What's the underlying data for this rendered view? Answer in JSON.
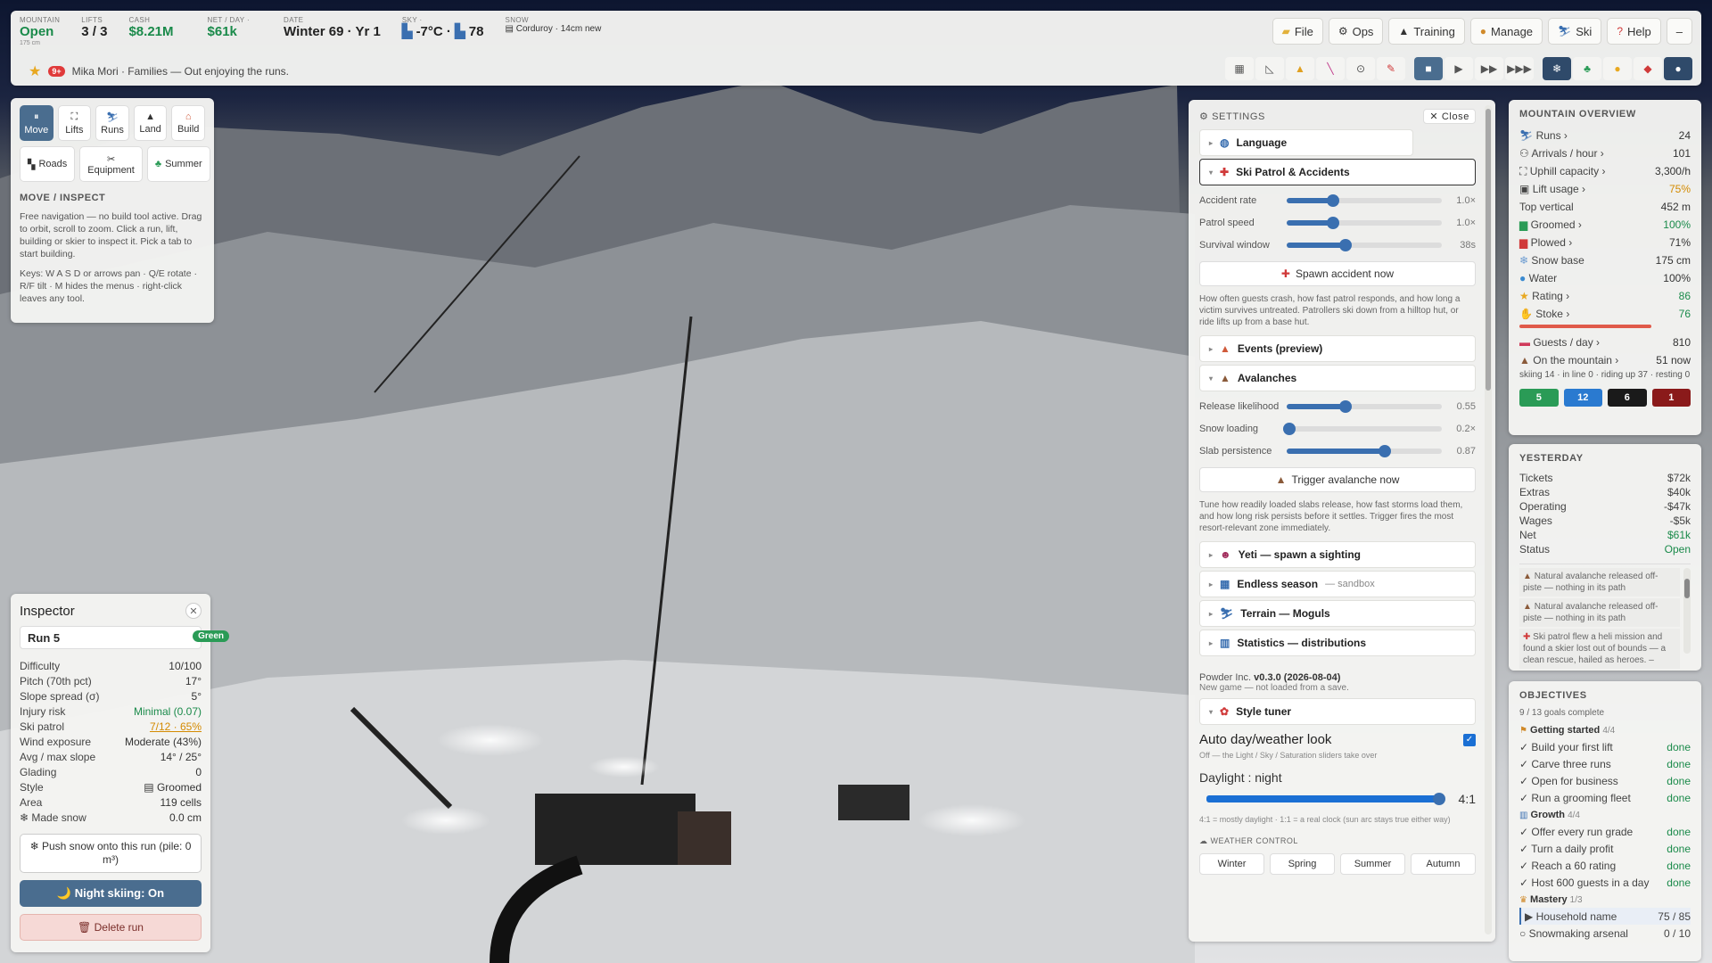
{
  "status": {
    "mountain": {
      "label": "MOUNTAIN",
      "value": "Open",
      "sub": "175 cm"
    },
    "lifts": {
      "label": "LIFTS",
      "value": "3 / 3"
    },
    "cash": {
      "label": "CASH",
      "value": "$8.21M"
    },
    "net": {
      "label": "NET / DAY ·",
      "value": "$61k"
    },
    "date": {
      "label": "DATE",
      "value": "Winter 69 · Yr 1"
    },
    "sky": {
      "label": "SKY ·",
      "temp": "-7°C ·",
      "value": "78"
    },
    "snow": {
      "label": "SNOW",
      "value": "Corduroy · 14cm new"
    }
  },
  "menu": [
    {
      "label": "File",
      "icon": "folder-icon"
    },
    {
      "label": "Ops",
      "icon": "gear-icon"
    },
    {
      "label": "Training",
      "icon": "cap-icon"
    },
    {
      "label": "Manage",
      "icon": "bag-icon"
    },
    {
      "label": "Ski",
      "icon": "skier-icon"
    },
    {
      "label": "Help",
      "icon": "question-icon"
    }
  ],
  "minimize": "–",
  "notification": {
    "count": "9+",
    "text": "Mika Mori · Families — Out enjoying the runs."
  },
  "tools": {
    "items": [
      {
        "label": "Move"
      },
      {
        "label": "Lifts"
      },
      {
        "label": "Runs"
      },
      {
        "label": "Land"
      },
      {
        "label": "Build"
      }
    ],
    "items2": [
      {
        "label": "Roads"
      },
      {
        "label": "Equipment"
      },
      {
        "label": "Summer"
      }
    ],
    "heading": "MOVE / INSPECT",
    "desc": "Free navigation — no build tool active. Drag to orbit, scroll to zoom. Click a run, lift, building or skier to inspect it. Pick a tab to start building.",
    "keys": "Keys: W A S D or arrows pan · Q/E rotate · R/F tilt · M hides the menus · right-click leaves any tool."
  },
  "inspector": {
    "title": "Inspector",
    "run": "Run 5",
    "grade": "Green",
    "rows": [
      {
        "k": "Difficulty",
        "v": "10/100"
      },
      {
        "k": "Pitch (70th pct)",
        "v": "17°"
      },
      {
        "k": "Slope spread (σ)",
        "v": "5°"
      },
      {
        "k": "Injury risk",
        "v": "Minimal (0.07)"
      },
      {
        "k": "Ski patrol",
        "v": "7/12 · 65%"
      },
      {
        "k": "Wind exposure",
        "v": "Moderate (43%)"
      },
      {
        "k": "Avg / max slope",
        "v": "14° / 25°"
      },
      {
        "k": "Glading",
        "v": "0"
      },
      {
        "k": "Style",
        "v": "▤ Groomed"
      },
      {
        "k": "Area",
        "v": "119 cells"
      },
      {
        "k": "❄ Made snow",
        "v": "0.0 cm"
      }
    ],
    "push": "❄ Push snow onto this run (pile: 0 m³)",
    "night": "🌙 Night skiing: On",
    "delete": "🗑 Delete run"
  },
  "settings": {
    "title": "SETTINGS",
    "close": "✕ Close",
    "language": "Language",
    "patrol": "Ski Patrol & Accidents",
    "patrol_sliders": [
      {
        "k": "Accident rate",
        "v": "1.0×",
        "frac": 0.3
      },
      {
        "k": "Patrol speed",
        "v": "1.0×",
        "frac": 0.3
      },
      {
        "k": "Survival window",
        "v": "38s",
        "frac": 0.38
      }
    ],
    "spawn": "Spawn accident now",
    "patrol_desc": "How often guests crash, how fast patrol responds, and how long a victim survives untreated. Patrollers ski down from a hilltop hut, or ride lifts up from a base hut.",
    "events": "Events (preview)",
    "avalanches": "Avalanches",
    "aval_sliders": [
      {
        "k": "Release likelihood",
        "v": "0.55",
        "frac": 0.38
      },
      {
        "k": "Snow loading",
        "v": "0.2×",
        "frac": 0.02
      },
      {
        "k": "Slab persistence",
        "v": "0.87",
        "frac": 0.63
      }
    ],
    "trigger": "Trigger avalanche now",
    "aval_desc": "Tune how readily loaded slabs release, how fast storms load them, and how long risk persists before it settles. Trigger fires the most resort-relevant zone immediately.",
    "yeti": "Yeti — spawn a sighting",
    "endless": "Endless season",
    "endless_sub": "— sandbox",
    "terrain": "Terrain — Moguls",
    "stats": "Statistics — distributions",
    "version_prefix": "Powder Inc.",
    "version": "v0.3.0 (2026-08-04)",
    "new_game": "New game — not loaded from a save.",
    "style": "Style tuner",
    "auto": "Auto day/weather look",
    "auto_note": "Off — the Light / Sky / Saturation sliders take over",
    "daylight": "Daylight : night",
    "ratio": "4:1",
    "ratio_note": "4:1 = mostly daylight · 1:1 = a real clock (sun arc stays true either way)",
    "weather": "WEATHER CONTROL",
    "seasons": [
      "Winter",
      "Spring",
      "Summer",
      "Autumn"
    ]
  },
  "overview": {
    "title": "MOUNTAIN OVERVIEW",
    "rows": [
      {
        "k": "Runs ›",
        "v": "24"
      },
      {
        "k": "Arrivals / hour ›",
        "v": "101"
      },
      {
        "k": "Uphill capacity ›",
        "v": "3,300/h"
      },
      {
        "k": "Lift usage ›",
        "v": "75%"
      },
      {
        "k": "Top vertical",
        "v": "452 m"
      },
      {
        "k": "Groomed ›",
        "v": "100%"
      },
      {
        "k": "Plowed ›",
        "v": "71%"
      },
      {
        "k": "Snow base",
        "v": "175 cm"
      },
      {
        "k": "Water",
        "v": "100%"
      },
      {
        "k": "Rating ›",
        "v": "86"
      },
      {
        "k": "Stoke ›",
        "v": "76"
      }
    ],
    "guests_k": "Guests / day ›",
    "guests_v": "810",
    "onmtn_k": "On the mountain ›",
    "onmtn_v": "51 now",
    "onmtn_detail": "skiing 14 · in line 0 · riding up 37 · resting 0",
    "pills": [
      "5",
      "12",
      "6",
      "1"
    ]
  },
  "yesterday": {
    "title": "YESTERDAY",
    "rows": [
      {
        "k": "Tickets",
        "v": "$72k"
      },
      {
        "k": "Extras",
        "v": "$40k"
      },
      {
        "k": "Operating",
        "v": "-$47k"
      },
      {
        "k": "Wages",
        "v": "-$5k"
      },
      {
        "k": "Net",
        "v": "$61k"
      },
      {
        "k": "Status",
        "v": "Open"
      }
    ],
    "logs": [
      "Natural avalanche released off-piste — nothing in its path",
      "Natural avalanche released off-piste — nothing in its path",
      "Ski patrol flew a heli mission and found a skier lost out of bounds — a clean rescue, hailed as heroes. –"
    ]
  },
  "objectives": {
    "title": "OBJECTIVES",
    "count": "9 / 13 goals complete",
    "g1": "Getting started",
    "g1n": "4/4",
    "g1items": [
      "✓ Build your first lift",
      "✓ Carve three runs",
      "✓ Open for business",
      "✓ Run a grooming fleet"
    ],
    "g2": "Growth",
    "g2n": "4/4",
    "g2items": [
      "✓ Offer every run grade",
      "✓ Turn a daily profit",
      "✓ Reach a 60 rating",
      "✓ Host 600 guests in a day"
    ],
    "done": "done",
    "g3": "Mastery",
    "g3n": "1/3",
    "p1": "▶ Household name",
    "p1v": "75 / 85",
    "p2": "○ Snowmaking arsenal",
    "p2v": "0 / 10"
  }
}
